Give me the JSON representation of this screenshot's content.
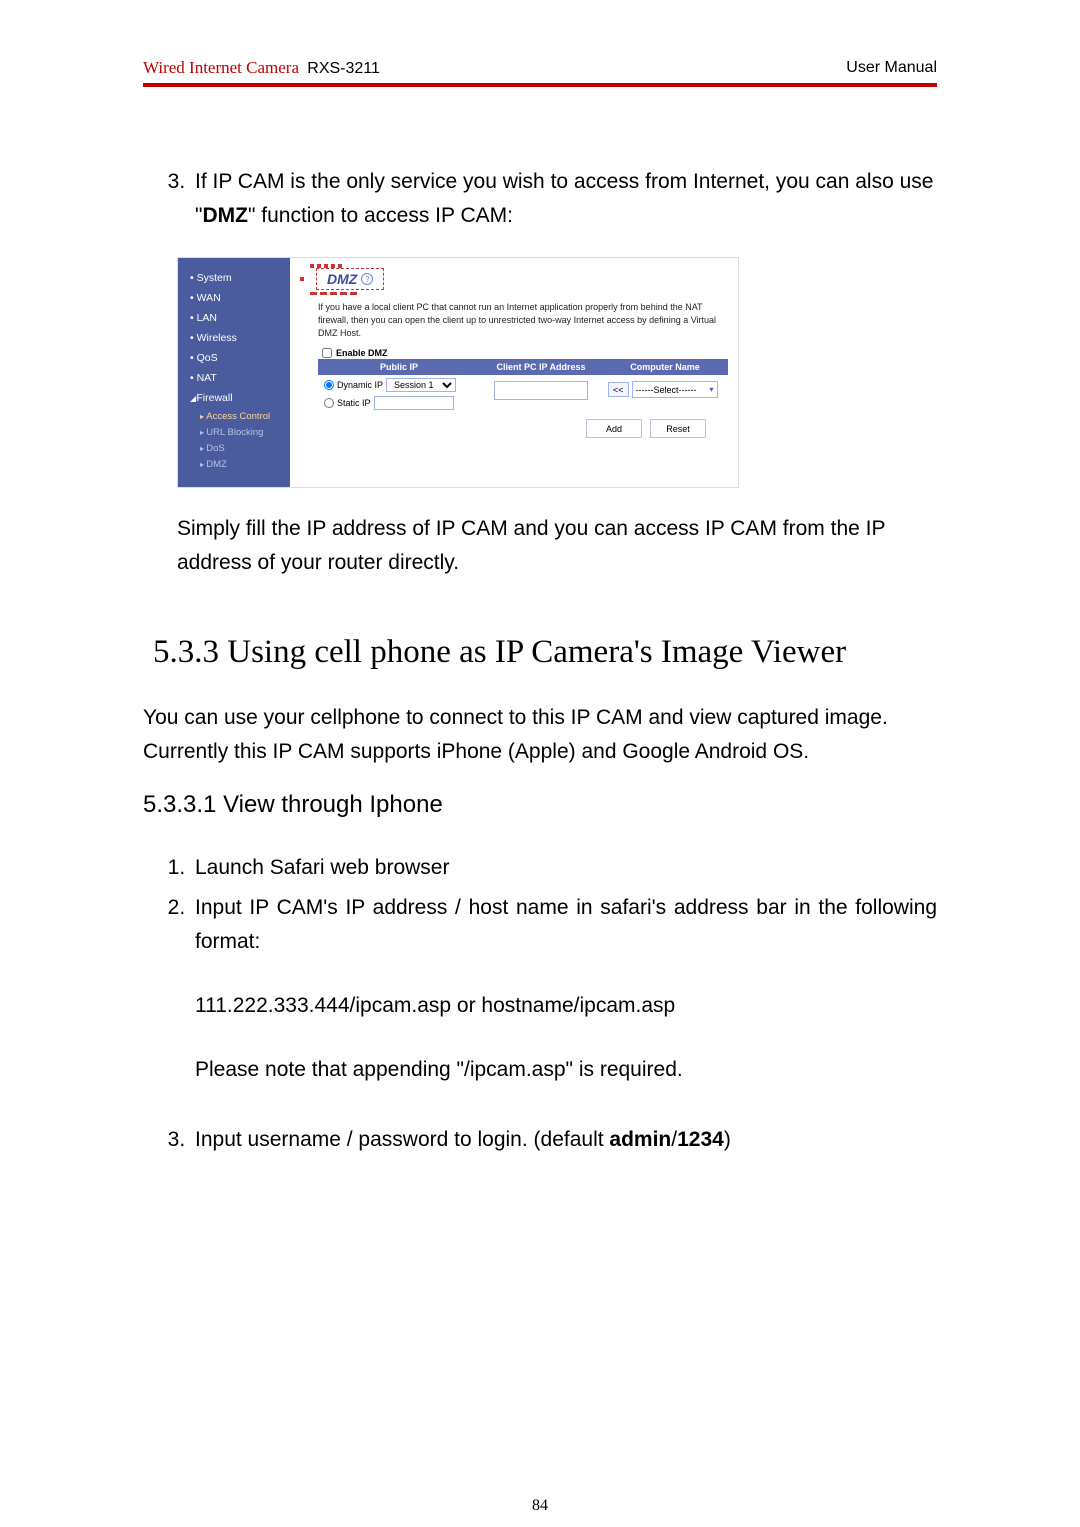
{
  "header": {
    "title_red": "Wired Internet Camera",
    "model": "RXS-3211",
    "right": "User Manual"
  },
  "step3": {
    "prefix": "If IP CAM is the only service you wish to access from Internet, you can also use \"",
    "bold": "DMZ",
    "suffix": "\" function to access IP CAM:"
  },
  "router": {
    "sidebar": {
      "items": [
        {
          "label": "System"
        },
        {
          "label": "WAN"
        },
        {
          "label": "LAN"
        },
        {
          "label": "Wireless"
        },
        {
          "label": "QoS"
        },
        {
          "label": "NAT"
        }
      ],
      "firewall_label": "Firewall",
      "subitems": [
        {
          "label": "Access Control"
        },
        {
          "label": "URL Blocking"
        },
        {
          "label": "DoS"
        },
        {
          "label": "DMZ"
        }
      ]
    },
    "main": {
      "badge": "DMZ",
      "desc": "If you have a local client PC that cannot run an Internet application properly from behind the NAT firewall, then you can open the client up to unrestricted two-way Internet access by defining a Virtual DMZ Host.",
      "enable_label": "Enable DMZ",
      "headers": {
        "public_ip": "Public IP",
        "client_ip": "Client PC IP Address",
        "computer_name": "Computer Name"
      },
      "dynamic_label": "Dynamic IP",
      "session_value": "Session 1",
      "static_label": "Static IP",
      "ll_btn": "<<",
      "select_text": "------Select------",
      "add_btn": "Add",
      "reset_btn": "Reset"
    }
  },
  "after_image": "Simply fill the IP address of IP CAM and you can access IP CAM from the IP address of your router directly.",
  "heading_533": "5.3.3 Using cell phone as IP Camera's Image Viewer",
  "para_533": "You can use your cellphone to connect to this IP CAM and view captured image. Currently this IP CAM supports iPhone (Apple) and Google Android OS.",
  "heading_5331": "5.3.3.1 View through Iphone",
  "iphone_steps": {
    "s1": "Launch Safari web browser",
    "s2": "Input IP CAM's IP address / host name in safari's address bar in the following format:",
    "s2_example": "111.222.333.444/ipcam.asp or hostname/ipcam.asp",
    "s2_note": "Please note that appending \"/ipcam.asp\" is required.",
    "s3_prefix": "Input username / password to login. (default ",
    "s3_bold": "admin",
    "s3_mid": "/",
    "s3_bold2": "1234",
    "s3_suffix": ")"
  },
  "page_number": "84"
}
